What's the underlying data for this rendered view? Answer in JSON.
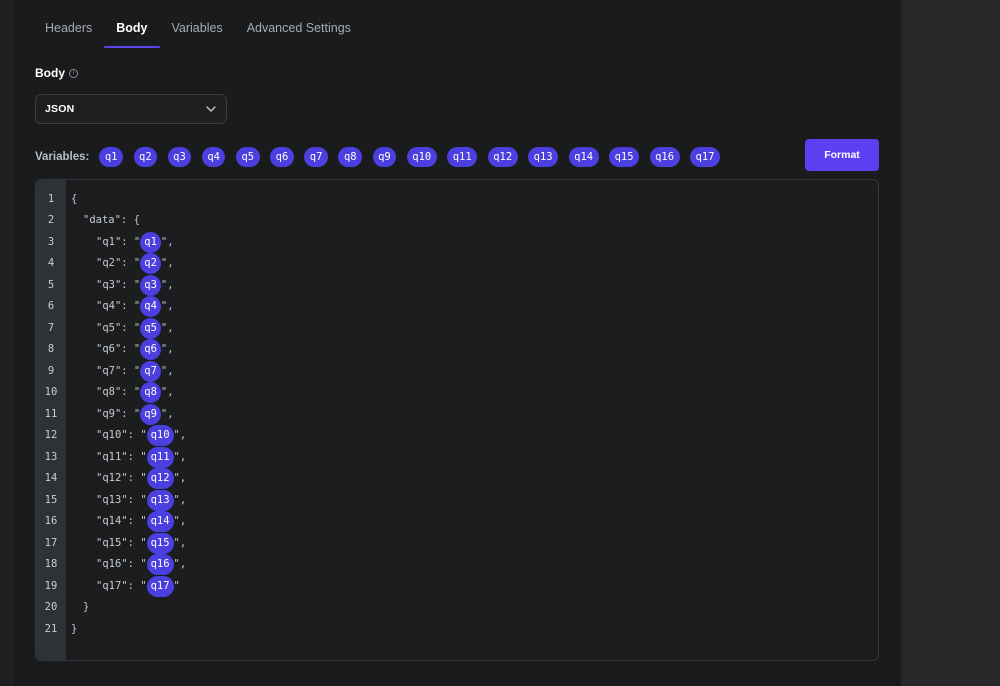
{
  "tabs": [
    {
      "label": "Headers",
      "active": false
    },
    {
      "label": "Body",
      "active": true
    },
    {
      "label": "Variables",
      "active": false
    },
    {
      "label": "Advanced Settings",
      "active": false
    }
  ],
  "body_section": {
    "label": "Body",
    "info_icon": "info-icon"
  },
  "body_type_select": {
    "value": "JSON",
    "icon": "chevron-down-icon"
  },
  "variables": {
    "label": "Variables:",
    "items": [
      "q1",
      "q2",
      "q3",
      "q4",
      "q5",
      "q6",
      "q7",
      "q8",
      "q9",
      "q10",
      "q11",
      "q12",
      "q13",
      "q14",
      "q15",
      "q16",
      "q17"
    ]
  },
  "format_button": {
    "label": "Format"
  },
  "editor": {
    "line_numbers": [
      "1",
      "2",
      "3",
      "4",
      "5",
      "6",
      "7",
      "8",
      "9",
      "10",
      "11",
      "12",
      "13",
      "14",
      "15",
      "16",
      "17",
      "18",
      "19",
      "20",
      "21"
    ],
    "open_brace": "{",
    "data_open": "\"data\": {",
    "entries": [
      {
        "key": "\"q1\": \"",
        "var": "q1",
        "suffix": "\","
      },
      {
        "key": "\"q2\": \"",
        "var": "q2",
        "suffix": "\","
      },
      {
        "key": "\"q3\": \"",
        "var": "q3",
        "suffix": "\","
      },
      {
        "key": "\"q4\": \"",
        "var": "q4",
        "suffix": "\","
      },
      {
        "key": "\"q5\": \"",
        "var": "q5",
        "suffix": "\","
      },
      {
        "key": "\"q6\": \"",
        "var": "q6",
        "suffix": "\","
      },
      {
        "key": "\"q7\": \"",
        "var": "q7",
        "suffix": "\","
      },
      {
        "key": "\"q8\": \"",
        "var": "q8",
        "suffix": "\","
      },
      {
        "key": "\"q9\": \"",
        "var": "q9",
        "suffix": "\","
      },
      {
        "key": "\"q10\": \"",
        "var": "q10",
        "suffix": "\","
      },
      {
        "key": "\"q11\": \"",
        "var": "q11",
        "suffix": "\","
      },
      {
        "key": "\"q12\": \"",
        "var": "q12",
        "suffix": "\","
      },
      {
        "key": "\"q13\": \"",
        "var": "q13",
        "suffix": "\","
      },
      {
        "key": "\"q14\": \"",
        "var": "q14",
        "suffix": "\","
      },
      {
        "key": "\"q15\": \"",
        "var": "q15",
        "suffix": "\","
      },
      {
        "key": "\"q16\": \"",
        "var": "q16",
        "suffix": "\","
      },
      {
        "key": "\"q17\": \"",
        "var": "q17",
        "suffix": "\""
      }
    ],
    "data_close": "}",
    "close_brace": "}"
  },
  "colors": {
    "accent": "#5b3ff2",
    "chip": "#4b3fe0",
    "panel_bg": "#191b1d",
    "gutter_bg": "#2e3236"
  }
}
